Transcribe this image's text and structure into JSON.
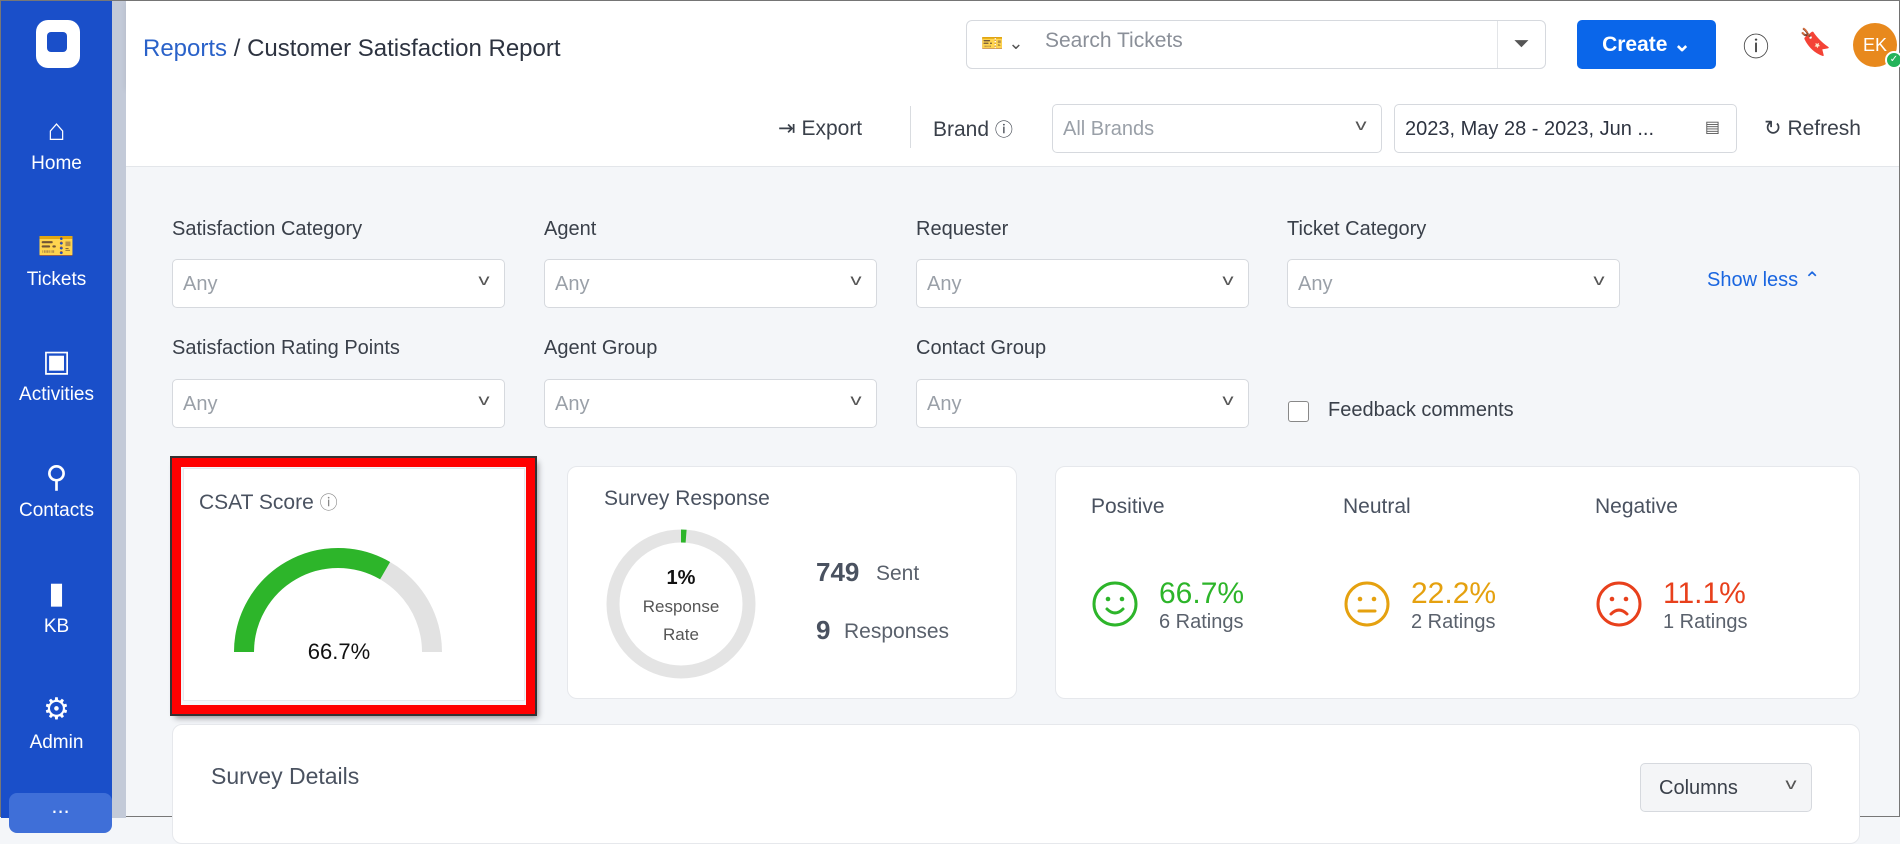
{
  "sidebar": {
    "items": [
      {
        "label": "Home",
        "icon": "home-icon"
      },
      {
        "label": "Tickets",
        "icon": "ticket-icon"
      },
      {
        "label": "Activities",
        "icon": "calendar-check-icon"
      },
      {
        "label": "Contacts",
        "icon": "user-icon"
      },
      {
        "label": "KB",
        "icon": "book-icon"
      },
      {
        "label": "Admin",
        "icon": "gear-icon"
      }
    ],
    "more": "..."
  },
  "header": {
    "breadcrumb_root": "Reports",
    "breadcrumb_sep": "/",
    "title": "Customer Satisfaction Report",
    "search_placeholder": "Search Tickets",
    "create_label": "Create",
    "avatar_initials": "EK"
  },
  "toolbar": {
    "export": "Export",
    "brand_label": "Brand",
    "brand_value": "All Brands",
    "date_range": "2023, May 28 - 2023, Jun ...",
    "refresh": "Refresh"
  },
  "filters": [
    {
      "label": "Satisfaction Category",
      "value": "Any"
    },
    {
      "label": "Agent",
      "value": "Any"
    },
    {
      "label": "Requester",
      "value": "Any"
    },
    {
      "label": "Ticket Category",
      "value": "Any"
    },
    {
      "label": "Satisfaction Rating Points",
      "value": "Any"
    },
    {
      "label": "Agent Group",
      "value": "Any"
    },
    {
      "label": "Contact Group",
      "value": "Any"
    }
  ],
  "show_less": "Show less",
  "feedback_comments": {
    "label": "Feedback comments",
    "checked": false
  },
  "csat": {
    "title": "CSAT Score",
    "value": "66.7%",
    "fraction": 0.667,
    "color": "#2db52a"
  },
  "survey": {
    "title": "Survey Response",
    "rate": "1%",
    "rate_label_1": "Response",
    "rate_label_2": "Rate",
    "rate_fraction": 0.012,
    "sent_count": "749",
    "sent_label": "Sent",
    "responses_count": "9",
    "responses_label": "Responses"
  },
  "sentiment": [
    {
      "label": "Positive",
      "pct": "66.7%",
      "ratings": "6 Ratings",
      "color": "#2db52a"
    },
    {
      "label": "Neutral",
      "pct": "22.2%",
      "ratings": "2 Ratings",
      "color": "#e5a10f"
    },
    {
      "label": "Negative",
      "pct": "11.1%",
      "ratings": "1 Ratings",
      "color": "#e8401c"
    }
  ],
  "survey_details": {
    "title": "Survey Details",
    "columns_button": "Columns"
  }
}
